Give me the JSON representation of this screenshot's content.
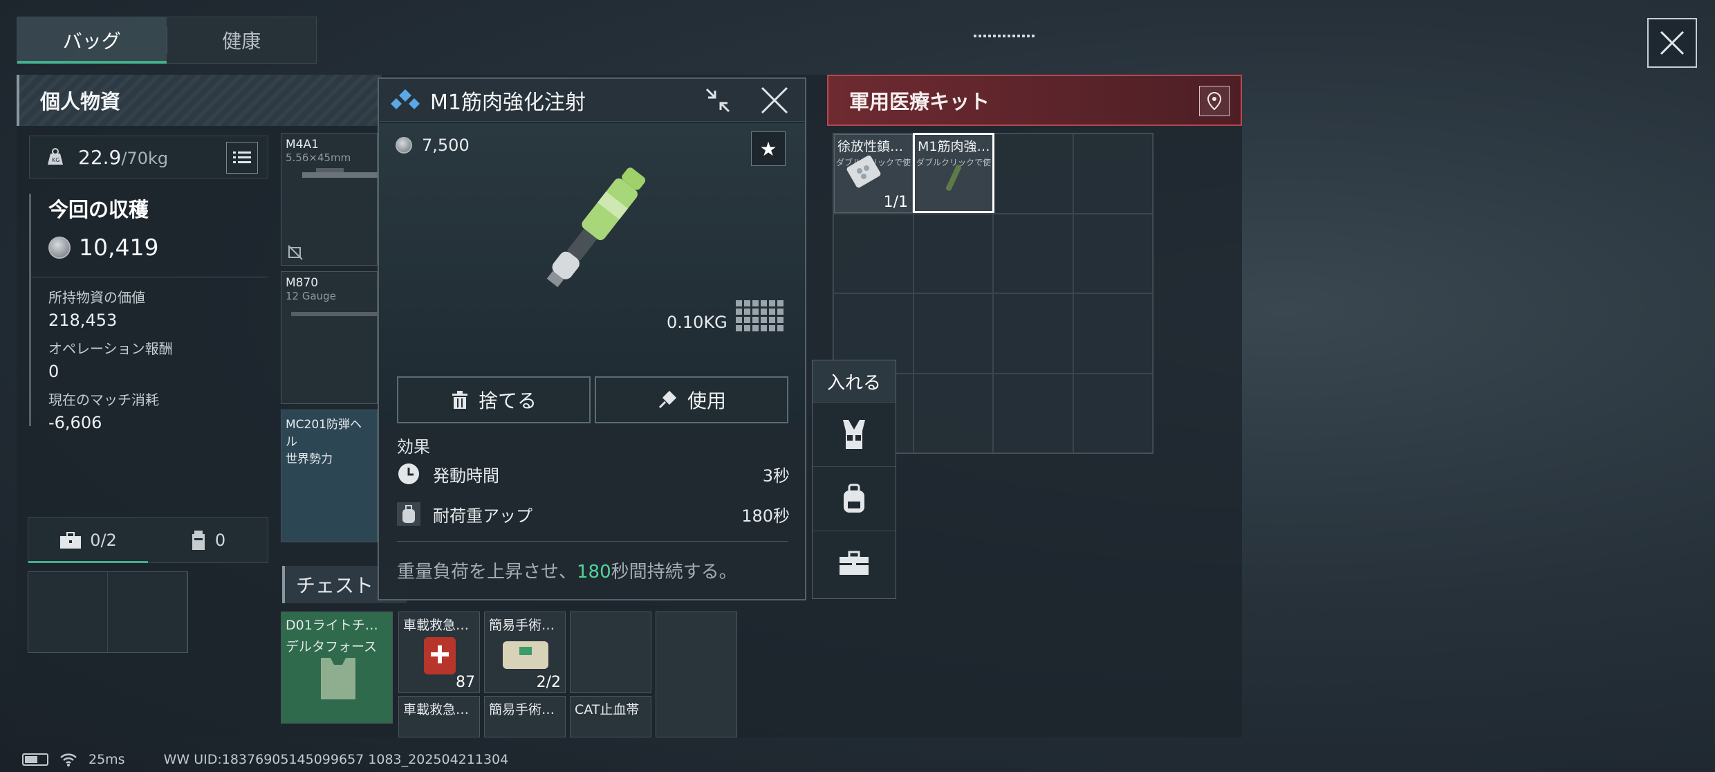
{
  "tabs": [
    {
      "label": "バッグ",
      "active": true
    },
    {
      "label": "健康",
      "active": false
    }
  ],
  "left_panel": {
    "title": "個人物資",
    "weight": {
      "current": "22.9",
      "max": "/70kg"
    },
    "harvest": {
      "title": "今回の収穫",
      "value": "10,419"
    },
    "stats": [
      {
        "label": "所持物資の価値",
        "value": "218,453"
      },
      {
        "label": "オペレーション報酬",
        "value": "0"
      },
      {
        "label": "現在のマッチ消耗",
        "value": "-6,606"
      }
    ],
    "sub_tabs": [
      {
        "label": "0/2",
        "icon": "briefcase-icon",
        "active": true
      },
      {
        "label": "0",
        "icon": "canister-icon",
        "active": false
      }
    ]
  },
  "items": [
    {
      "name": "M4A1",
      "sub": "5.56×45mm"
    },
    {
      "name": "M870",
      "sub": "12 Gauge"
    },
    {
      "name": "MC201防弾ヘル",
      "sub": "世界勢力"
    }
  ],
  "chest": {
    "title": "チェスト",
    "cells": [
      {
        "name": "D01ライトチ…",
        "sub": "デルタフォース"
      },
      {
        "name": "車載救急…",
        "count": "87"
      },
      {
        "name": "簡易手術…",
        "count": "2/2"
      },
      {
        "name": "車載救急…"
      },
      {
        "name": "簡易手術…"
      },
      {
        "name": "CAT止血帯"
      }
    ]
  },
  "popup": {
    "title": "M1筋肉強化注射",
    "price": "7,500",
    "weight": "0.10KG",
    "discard_label": "捨てる",
    "use_label": "使用",
    "effect_title": "効果",
    "effects": [
      {
        "label": "発動時間",
        "value": "3秒",
        "icon": "clock-icon"
      },
      {
        "label": "耐荷重アップ",
        "value": "180秒",
        "icon": "backpack-icon"
      }
    ],
    "description_pre": "重量負荷を上昇させ、",
    "description_highlight": "180",
    "description_post": "秒間持続する。"
  },
  "insert_menu": {
    "title": "入れる",
    "items": [
      "vest-icon",
      "backpack-icon",
      "briefcase-icon"
    ]
  },
  "right_panel": {
    "title": "軍用医療キット",
    "cells": [
      {
        "name": "徐放性鎮…",
        "hint": "ダブルクリックで使う",
        "count": "1/1",
        "selected": false
      },
      {
        "name": "M1筋肉強…",
        "hint": "ダブルクリックで使う",
        "selected": true
      }
    ]
  },
  "status": {
    "ping": "25ms",
    "uid": "WW UID:18376905145099657 1083_202504211304"
  },
  "colors": {
    "accent": "#43b08c",
    "highlight": "#4fd39c",
    "alert_header": "#6e2a31"
  }
}
